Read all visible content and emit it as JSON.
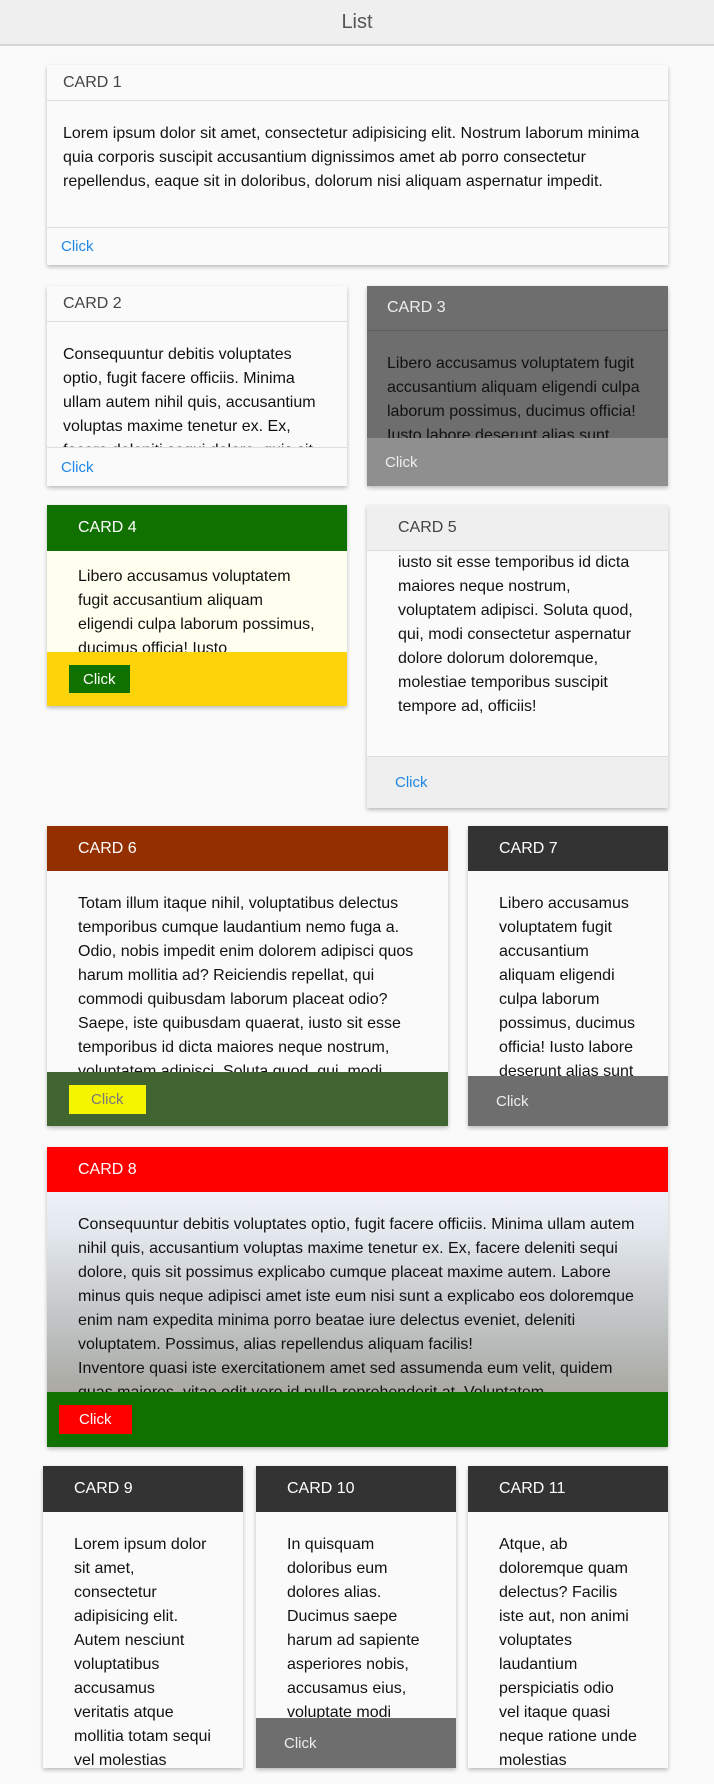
{
  "topbar": {
    "title": "List"
  },
  "colors": {
    "link": "#1e88e5",
    "green": "#107000",
    "yellow": "#ffd30a",
    "rust": "#943000",
    "dark": "#333333",
    "red": "#ff0000",
    "olive": "#416530",
    "gray": "#6e6e6e"
  },
  "cards": [
    {
      "title": "CARD 1",
      "body": "Lorem ipsum dolor sit amet, consectetur adipisicing elit. Nostrum laborum minima quia corporis suscipit accusantium dignissimos amet ab porro consectetur repellendus, eaque sit in doloribus, dolorum nisi aliquam aspernatur impedit.",
      "button": "Click"
    },
    {
      "title": "CARD 2",
      "body": "Consequuntur debitis voluptates optio, fugit facere officiis. Minima ullam autem nihil quis, accusantium voluptas maxime tenetur ex. Ex, facere deleniti sequi dolore, quis sit",
      "button": "Click"
    },
    {
      "title": "CARD 3",
      "body": "Libero accusamus voluptatem fugit accusantium aliquam eligendi culpa laborum possimus, ducimus officia! Iusto labore deserunt alias sunt",
      "button": "Click"
    },
    {
      "title": "CARD 4",
      "body": "Libero accusamus voluptatem fugit accusantium aliquam eligendi culpa laborum possimus, ducimus officia! Iusto",
      "button": "Click"
    },
    {
      "title": "CARD 5",
      "body": "iusto sit esse temporibus id dicta maiores neque nostrum, voluptatem adipisci. Soluta quod, qui, modi consectetur aspernatur dolore dolorum doloremque, molestiae temporibus suscipit tempore ad, officiis!",
      "button": "Click"
    },
    {
      "title": "CARD 6",
      "body": "Totam illum itaque nihil, voluptatibus delectus temporibus cumque laudantium nemo fuga a. Odio, nobis impedit enim dolorem adipisci quos harum mollitia ad? Reiciendis repellat, qui commodi quibusdam laborum placeat odio? Saepe, iste quibusdam quaerat, iusto sit esse temporibus id dicta maiores neque nostrum, voluptatem adipisci. Soluta quod, qui, modi",
      "button": "Click"
    },
    {
      "title": "CARD 7",
      "body": "Libero accusamus voluptatem fugit accusantium aliquam eligendi culpa laborum possimus, ducimus officia! Iusto labore deserunt alias sunt",
      "button": "Click"
    },
    {
      "title": "CARD 8",
      "body": "Consequuntur debitis voluptates optio, fugit facere officiis. Minima ullam autem nihil quis, accusantium voluptas maxime tenetur ex. Ex, facere deleniti sequi dolore, quis sit possimus explicabo cumque placeat maxime autem. Labore minus quis neque adipisci amet iste eum nisi sunt a explicabo eos doloremque enim nam expedita minima porro beatae iure delectus eveniet, deleniti voluptatem. Possimus, alias repellendus aliquam facilis!\nInventore quasi iste exercitationem amet sed assumenda eum velit, quidem quas maiores, vitae odit vero id nulla reprehenderit at. Voluptatem",
      "button": "Click"
    },
    {
      "title": "CARD 9",
      "body": "Lorem ipsum dolor sit amet, consectetur adipisicing elit. Autem nesciunt voluptatibus accusamus veritatis atque mollitia totam sequi vel molestias"
    },
    {
      "title": "CARD 10",
      "body": "In quisquam doloribus eum dolores alias. Ducimus saepe harum ad sapiente asperiores nobis, accusamus eius, voluptate modi",
      "button": "Click"
    },
    {
      "title": "CARD 11",
      "body": "Atque, ab doloremque quam delectus? Facilis iste aut, non animi voluptates laudantium perspiciatis odio vel itaque quasi neque ratione unde molestias"
    }
  ]
}
